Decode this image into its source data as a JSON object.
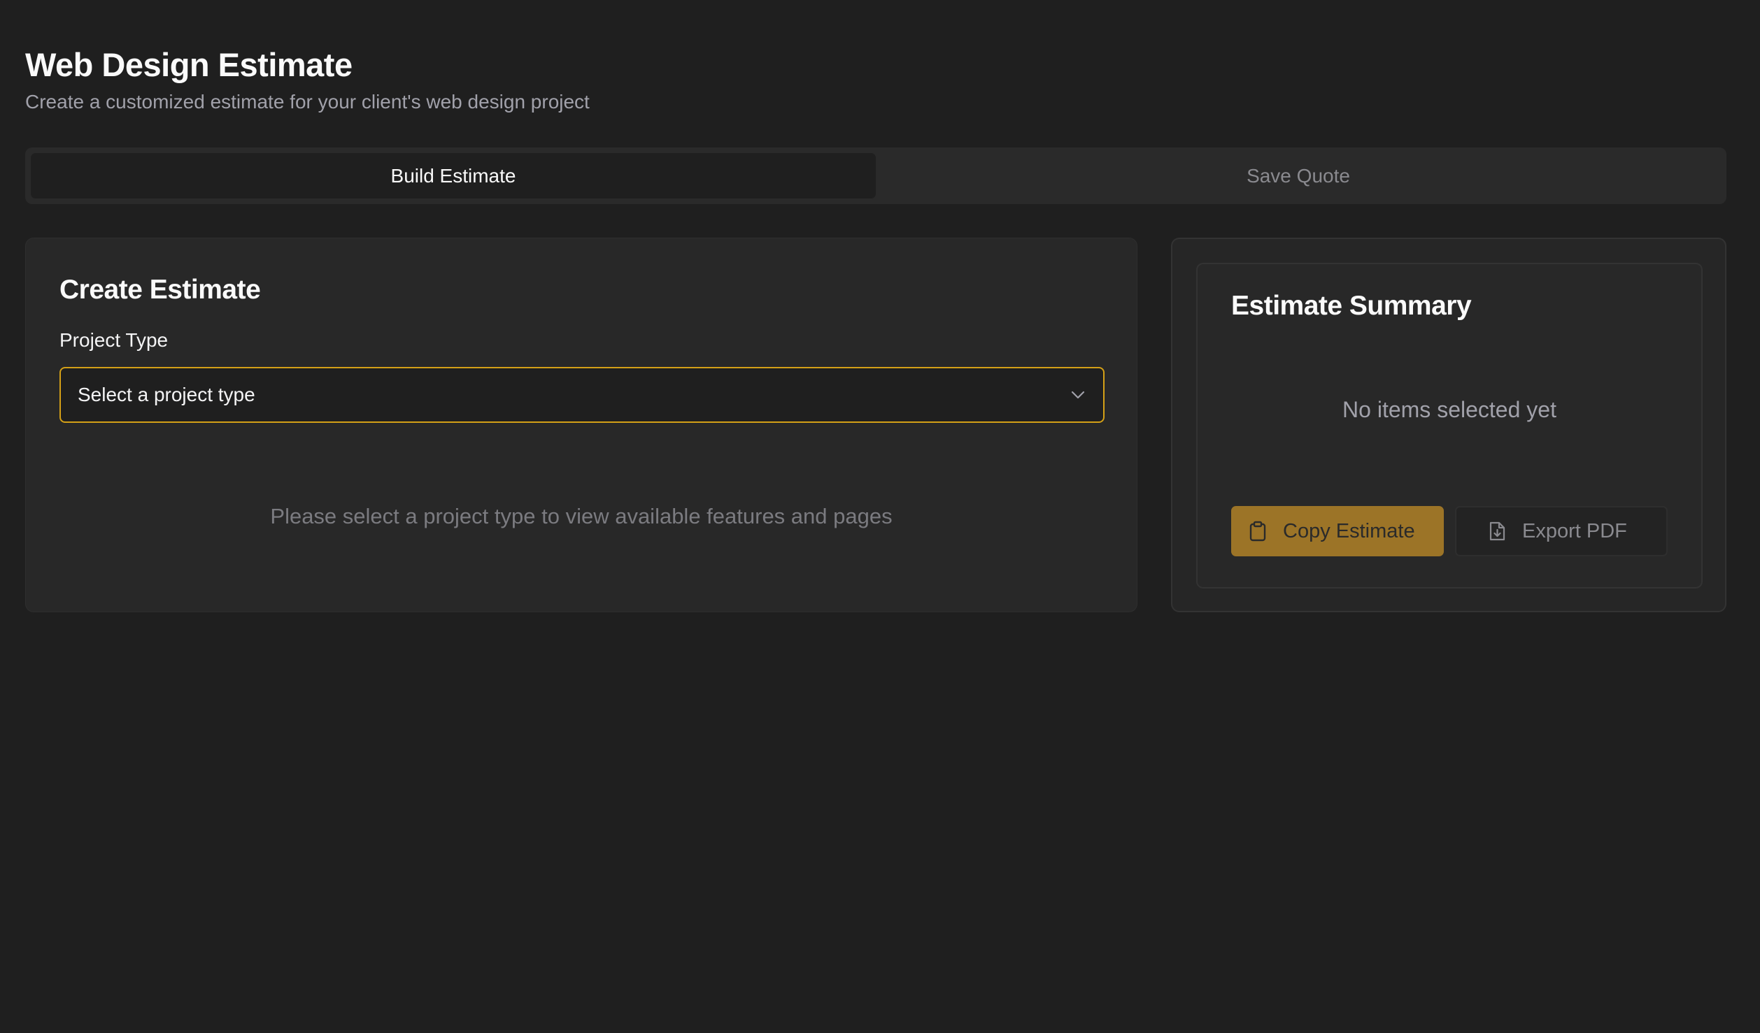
{
  "header": {
    "title": "Web Design Estimate",
    "subtitle": "Create a customized estimate for your client's web design project"
  },
  "tabs": [
    {
      "label": "Build Estimate",
      "active": true
    },
    {
      "label": "Save Quote",
      "active": false
    }
  ],
  "create": {
    "title": "Create Estimate",
    "project_type_label": "Project Type",
    "project_type_placeholder": "Select a project type",
    "empty_hint": "Please select a project type to view available features and pages"
  },
  "summary": {
    "title": "Estimate Summary",
    "empty_text": "No items selected yet",
    "copy_label": "Copy Estimate",
    "copy_icon": "clipboard-icon",
    "export_label": "Export PDF",
    "export_icon": "file-download-icon"
  },
  "colors": {
    "background": "#1f1f1f",
    "accent": "#d4a017",
    "primary_button": "#9c7427"
  }
}
